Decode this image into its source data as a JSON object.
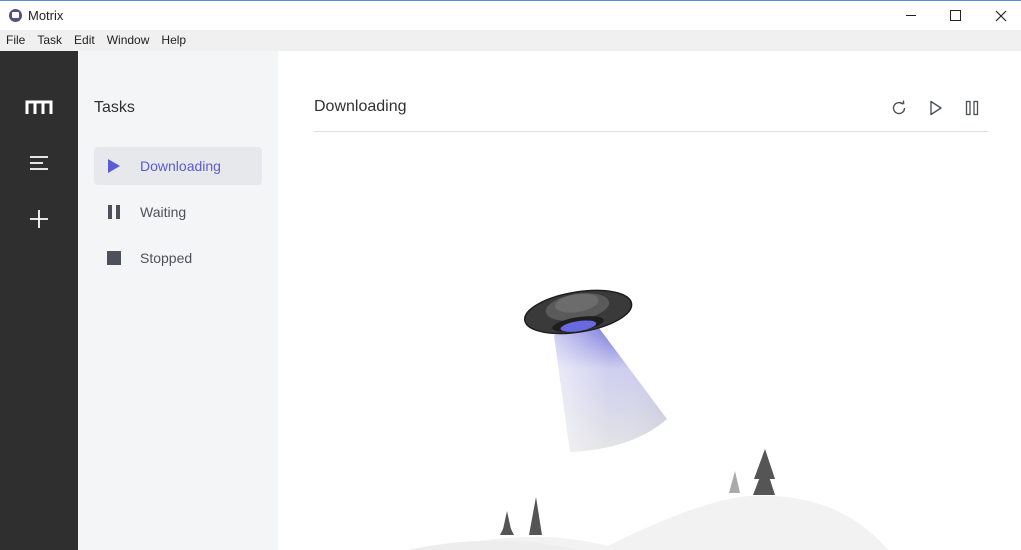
{
  "window": {
    "title": "Motrix"
  },
  "menu": [
    "File",
    "Task",
    "Edit",
    "Window",
    "Help"
  ],
  "aside": {
    "icons": [
      "motrix-logo-icon",
      "menu-list-icon",
      "add-icon"
    ]
  },
  "subnav": {
    "title": "Tasks",
    "items": [
      {
        "label": "Downloading",
        "icon": "play-icon",
        "active": true
      },
      {
        "label": "Waiting",
        "icon": "pause-icon",
        "active": false
      },
      {
        "label": "Stopped",
        "icon": "stop-icon",
        "active": false
      }
    ]
  },
  "main": {
    "title": "Downloading",
    "actions": [
      "refresh-icon",
      "play-icon",
      "pause-icon"
    ],
    "empty_state": "ufo-illustration"
  },
  "colors": {
    "accent": "#5b5bd6",
    "aside_bg": "#2f2f2f",
    "subnav_bg": "#f4f5f7"
  }
}
